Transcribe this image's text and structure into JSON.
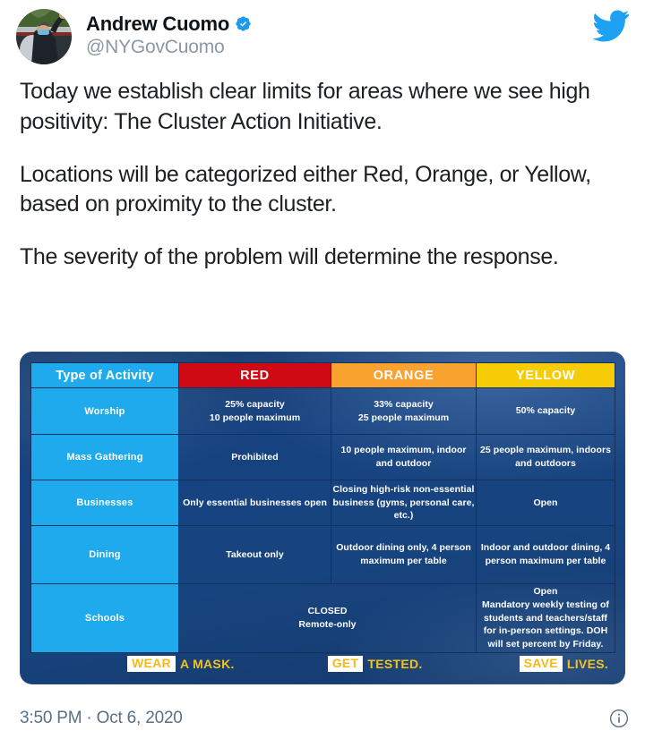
{
  "tweet": {
    "author": {
      "display_name": "Andrew Cuomo",
      "handle": "@NYGovCuomo",
      "verified": true,
      "avatar_alt": "avatar"
    },
    "platform_icon": "twitter-bird-icon",
    "paragraphs": [
      "Today we establish clear limits for areas where we see high positivity: The Cluster Action Initiative.",
      "Locations will be categorized either Red, Orange, or Yellow, based on proximity to the cluster.",
      "The severity of the problem will determine the response."
    ],
    "timestamp": "3:50 PM · Oct 6, 2020",
    "info_icon": "info-circle-icon"
  },
  "graphic": {
    "colors": {
      "activity_header": "#1eaaed",
      "red": "#cf0a14",
      "orange": "#f9a230",
      "yellow": "#f6cc07",
      "sky_dark": "#17447f",
      "slogan_gold": "#f5c21a"
    },
    "table": {
      "headers": {
        "activity": "Type of Activity",
        "red": "RED",
        "orange": "ORANGE",
        "yellow": "YELLOW"
      },
      "rows": [
        {
          "activity": "Worship",
          "red": "25% capacity\n10 people maximum",
          "orange": "33% capacity\n25 people maximum",
          "yellow": "50% capacity"
        },
        {
          "activity": "Mass Gathering",
          "red": "Prohibited",
          "orange": "10 people maximum, indoor and outdoor",
          "yellow": "25 people maximum, indoors and outdoors"
        },
        {
          "activity": "Businesses",
          "red": "Only essential businesses open",
          "orange": "Closing high-risk non-essential business (gyms, personal care,  etc.)",
          "yellow": "Open"
        },
        {
          "activity": "Dining",
          "red": "Takeout only",
          "orange": "Outdoor dining only, 4 person maximum per table",
          "yellow": "Indoor and outdoor dining, 4 person maximum per table"
        },
        {
          "activity": "Schools",
          "red_orange_merged": "CLOSED\nRemote-only",
          "yellow": "Open\nMandatory weekly testing of students and teachers/staff for in-person settings. DOH will set percent by Friday."
        }
      ]
    },
    "slogans": [
      {
        "highlight": "WEAR",
        "rest": "A MASK."
      },
      {
        "highlight": "GET",
        "rest": "TESTED."
      },
      {
        "highlight": "SAVE",
        "rest": "LIVES."
      }
    ]
  }
}
